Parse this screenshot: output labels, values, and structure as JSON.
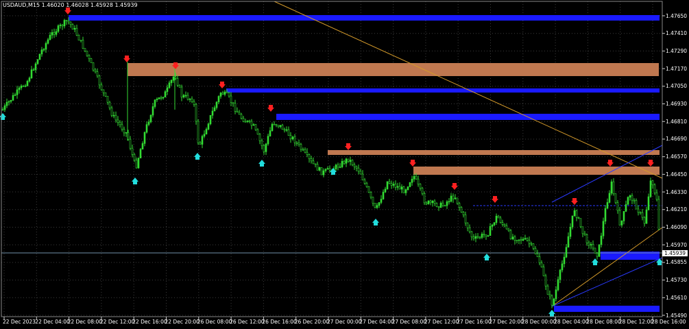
{
  "header": {
    "symbol_text": "USDAUD,M15  1.46020 1.46028 1.45928 1.45939"
  },
  "colors": {
    "background": "#000000",
    "grid": "#3c3c3c",
    "candle": "#33dd33",
    "supply_zone": "#c07850",
    "demand_zone": "#1a1aff",
    "down_arrow": "#ff2020",
    "up_arrow": "#22dddd",
    "trend_line": "#d49a2a",
    "channel_line": "#2a3aff",
    "bid_line": "#6f8fa8"
  },
  "price_axis": {
    "ticks": [
      "1.47650",
      "1.47410",
      "1.47290",
      "1.47170",
      "1.47050",
      "1.46930",
      "1.46810",
      "1.46690",
      "1.46570",
      "1.46450",
      "1.46330",
      "1.46210",
      "1.46090",
      "1.45970",
      "1.45855",
      "1.45730",
      "1.45610",
      "1.45490"
    ],
    "current_price": "1.45939"
  },
  "time_axis": {
    "ticks": [
      "22 Dec 2023",
      "22 Dec 04:00",
      "22 Dec 08:00",
      "22 Dec 12:00",
      "22 Dec 16:00",
      "22 Dec 20:00",
      "26 Dec 08:00",
      "26 Dec 12:00",
      "26 Dec 16:00",
      "26 Dec 20:00",
      "27 Dec 00:00",
      "27 Dec 04:00",
      "27 Dec 08:00",
      "27 Dec 12:00",
      "27 Dec 16:00",
      "27 Dec 20:00",
      "28 Dec 00:00",
      "28 Dec 04:00",
      "28 Dec 08:00",
      "28 Dec 12:00",
      "28 Dec 16:00"
    ]
  }
}
